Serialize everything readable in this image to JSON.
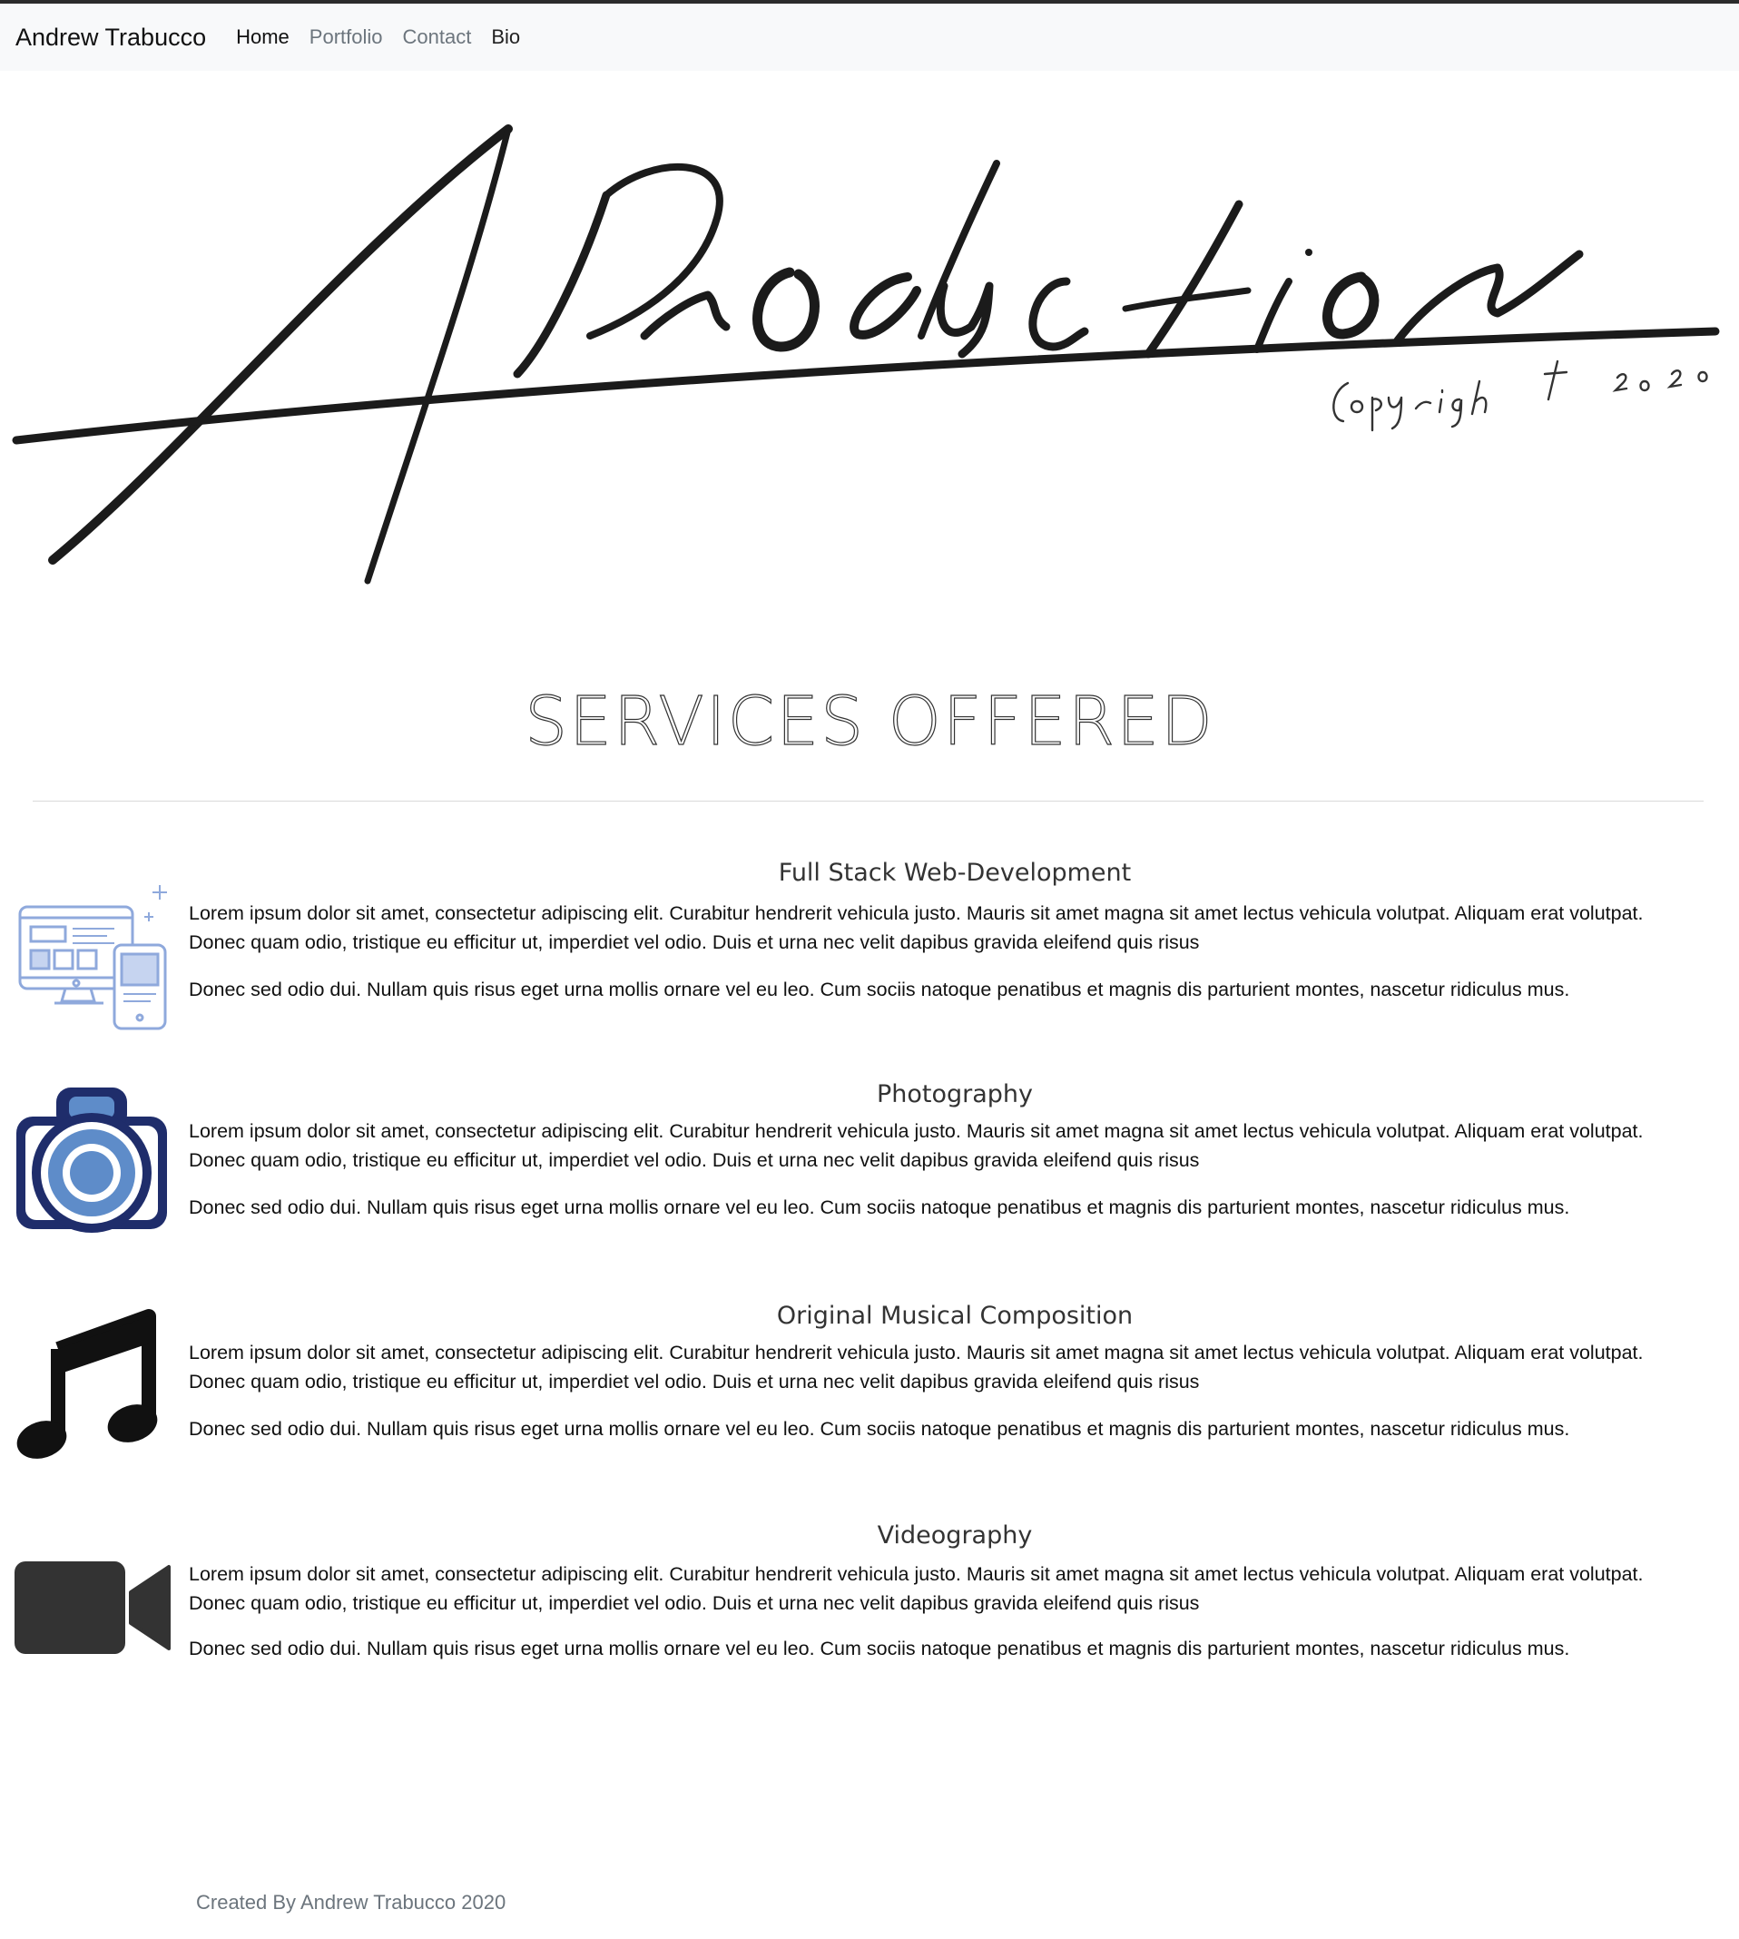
{
  "navbar": {
    "brand": "Andrew Trabucco",
    "links": [
      "Home",
      "Portfolio",
      "Contact",
      "Bio"
    ]
  },
  "logo": {
    "text": "AProduction",
    "copyright": "Copyright 2020"
  },
  "services": {
    "title": "SERVICES OFFERED",
    "items": [
      {
        "title": "Full Stack Web-Development",
        "icon": "web-devices-icon",
        "paragraph1": "Lorem ipsum dolor sit amet, consectetur adipiscing elit. Curabitur hendrerit vehicula justo. Mauris sit amet magna sit amet lectus vehicula volutpat. Aliquam erat volutpat. Donec quam odio, tristique eu efficitur ut, imperdiet vel odio. Duis et urna nec velit dapibus gravida eleifend quis risus",
        "paragraph2": "Donec sed odio dui. Nullam quis risus eget urna mollis ornare vel eu leo. Cum sociis natoque penatibus et magnis dis parturient montes, nascetur ridiculus mus."
      },
      {
        "title": "Photography",
        "icon": "camera-icon",
        "paragraph1": "Lorem ipsum dolor sit amet, consectetur adipiscing elit. Curabitur hendrerit vehicula justo. Mauris sit amet magna sit amet lectus vehicula volutpat. Aliquam erat volutpat. Donec quam odio, tristique eu efficitur ut, imperdiet vel odio. Duis et urna nec velit dapibus gravida eleifend quis risus",
        "paragraph2": "Donec sed odio dui. Nullam quis risus eget urna mollis ornare vel eu leo. Cum sociis natoque penatibus et magnis dis parturient montes, nascetur ridiculus mus."
      },
      {
        "title": "Original Musical Composition",
        "icon": "music-note-icon",
        "paragraph1": "Lorem ipsum dolor sit amet, consectetur adipiscing elit. Curabitur hendrerit vehicula justo. Mauris sit amet magna sit amet lectus vehicula volutpat. Aliquam erat volutpat. Donec quam odio, tristique eu efficitur ut, imperdiet vel odio. Duis et urna nec velit dapibus gravida eleifend quis risus",
        "paragraph2": "Donec sed odio dui. Nullam quis risus eget urna mollis ornare vel eu leo. Cum sociis natoque penatibus et magnis dis parturient montes, nascetur ridiculus mus."
      },
      {
        "title": "Videography",
        "icon": "video-camera-icon",
        "paragraph1": "Lorem ipsum dolor sit amet, consectetur adipiscing elit. Curabitur hendrerit vehicula justo. Mauris sit amet magna sit amet lectus vehicula volutpat. Aliquam erat volutpat. Donec quam odio, tristique eu efficitur ut, imperdiet vel odio. Duis et urna nec velit dapibus gravida eleifend quis risus",
        "paragraph2": "Donec sed odio dui. Nullam quis risus eget urna mollis ornare vel eu leo. Cum sociis natoque penatibus et magnis dis parturient montes, nascetur ridiculus mus."
      }
    ]
  },
  "footer": {
    "text": "Created By Andrew Trabucco 2020"
  },
  "colors": {
    "navbar_bg": "#f8f9fa",
    "nav_inactive": "#6c757d",
    "camera_dark": "#1f2d6b",
    "camera_light": "#5e8cc9",
    "web_icon_blue": "#8fa9dc",
    "icon_black": "#111111",
    "video_icon": "#333333"
  }
}
